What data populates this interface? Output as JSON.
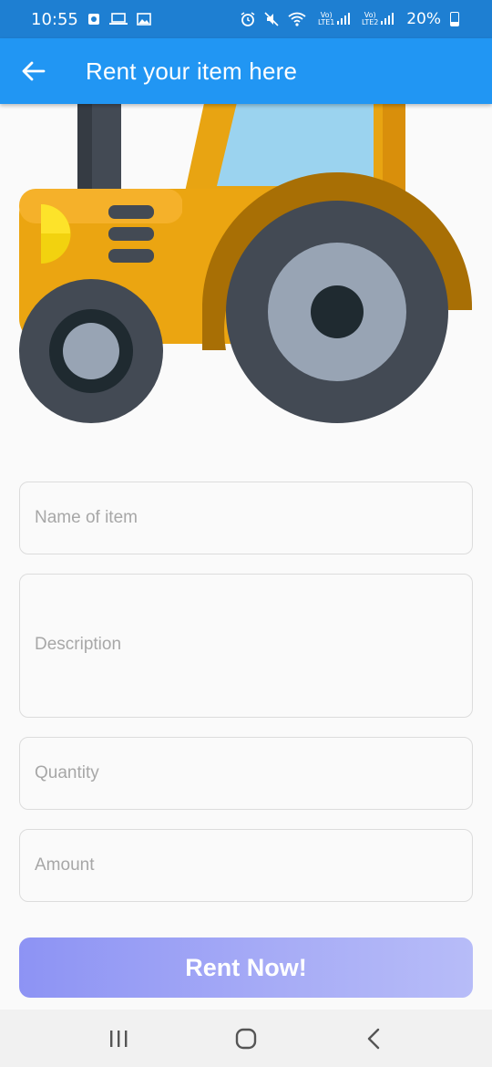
{
  "status_bar": {
    "time": "10:55",
    "battery": "20%",
    "sim1_label": "Vo) LTE1",
    "sim2_label": "Vo) LTE2",
    "icons": [
      "app-notification-icon",
      "laptop-icon",
      "image-icon",
      "alarm-icon",
      "mute-icon",
      "wifi-icon",
      "signal-icon",
      "signal-icon",
      "battery-icon"
    ]
  },
  "app_bar": {
    "title": "Rent your item here",
    "back_icon": "arrow-left-icon",
    "color": "#2196f3"
  },
  "hero": {
    "illustration": "tractor-icon"
  },
  "form": {
    "name_placeholder": "Name of item",
    "description_placeholder": "Description",
    "quantity_placeholder": "Quantity",
    "amount_placeholder": "Amount",
    "submit_label": "Rent Now!"
  },
  "nav_bar": {
    "recents_icon": "recents-icon",
    "home_icon": "home-icon",
    "back_icon": "back-chevron-icon"
  }
}
